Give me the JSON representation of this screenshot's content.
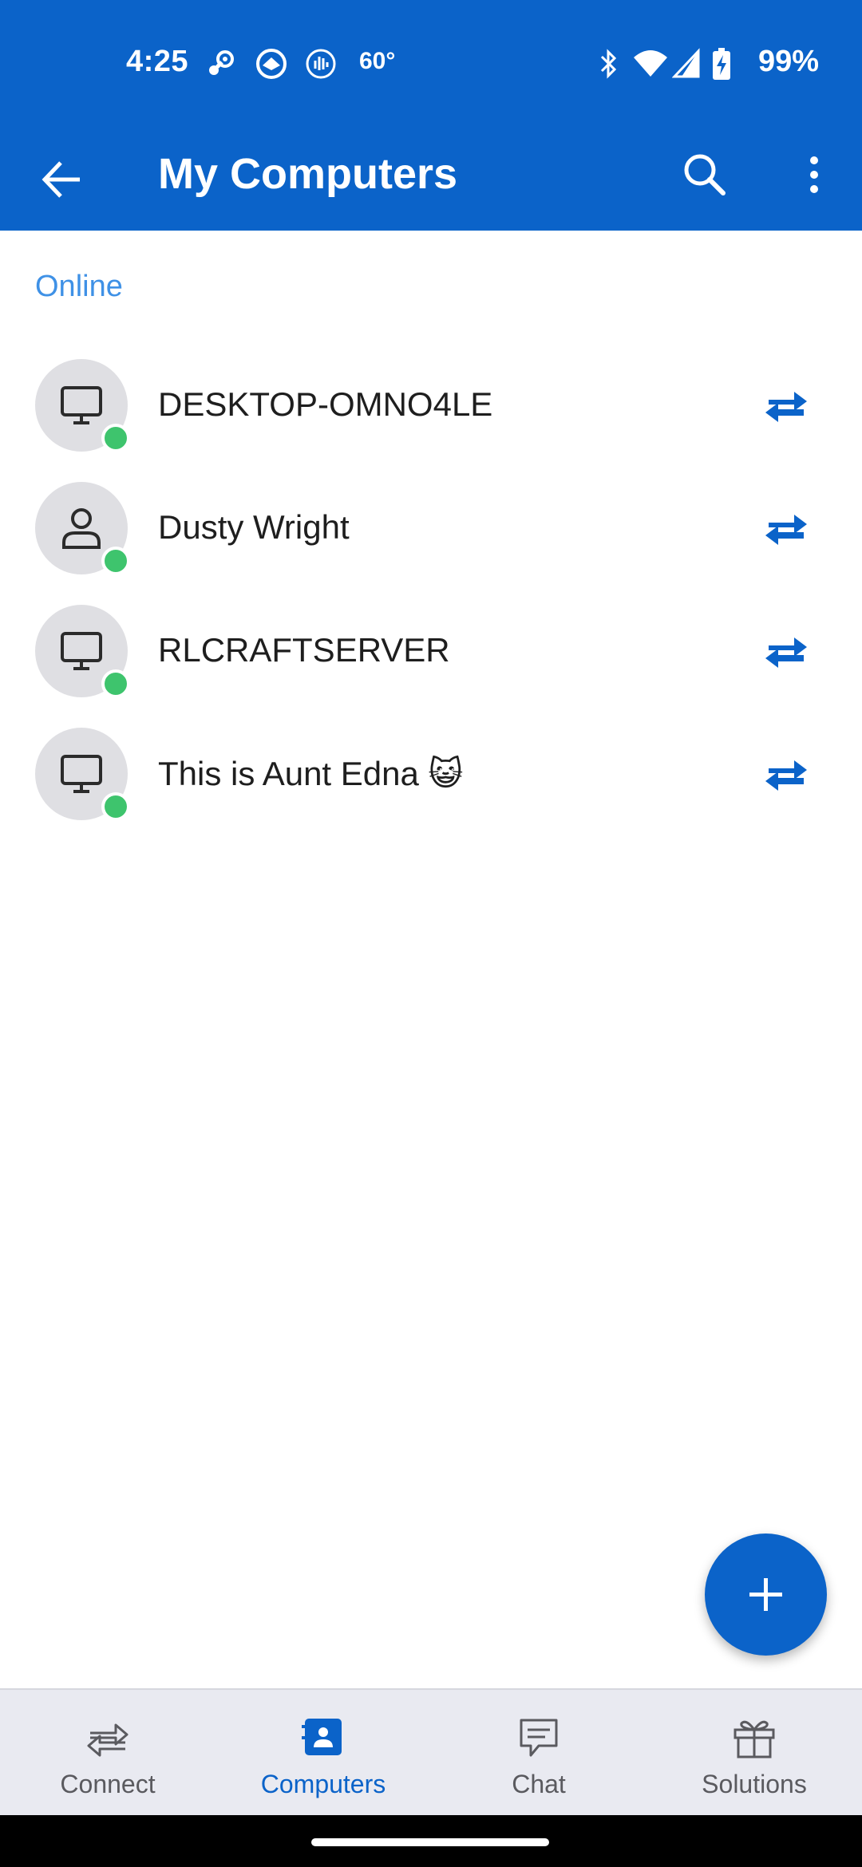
{
  "status_bar": {
    "time": "4:25",
    "notification_icons": [
      "steam-icon",
      "rocket-icon",
      "audio-wave-icon",
      "temperature-icon"
    ],
    "temperature": "60°",
    "system_icons": [
      "bluetooth-icon",
      "wifi-icon",
      "signal-icon",
      "battery-charging-icon"
    ],
    "battery": "99%"
  },
  "app_bar": {
    "title": "My Computers",
    "icons": [
      "back-arrow-icon",
      "search-icon",
      "more-vert-icon"
    ]
  },
  "section": {
    "label": "Online"
  },
  "computers": [
    {
      "name": "DESKTOP-OMNO4LE",
      "icon": "monitor-icon",
      "status": "online"
    },
    {
      "name": "Dusty Wright",
      "icon": "person-icon",
      "status": "online"
    },
    {
      "name": "RLCRAFTSERVER",
      "icon": "monitor-icon",
      "status": "online"
    },
    {
      "name": "This is Aunt Edna 😺",
      "icon": "monitor-icon",
      "status": "online"
    }
  ],
  "fab": {
    "icon": "plus-icon"
  },
  "bottom_nav": {
    "items": [
      {
        "label": "Connect",
        "icon": "connect-arrows-icon",
        "active": false
      },
      {
        "label": "Computers",
        "icon": "contacts-book-icon",
        "active": true
      },
      {
        "label": "Chat",
        "icon": "chat-bubble-icon",
        "active": false
      },
      {
        "label": "Solutions",
        "icon": "gift-box-icon",
        "active": false
      }
    ]
  },
  "colors": {
    "primary": "#0b63c9",
    "section_label": "#3f91e6",
    "online": "#3ec46d",
    "avatar_bg": "#dfdfe3",
    "nav_bg": "#e9eaf1"
  }
}
